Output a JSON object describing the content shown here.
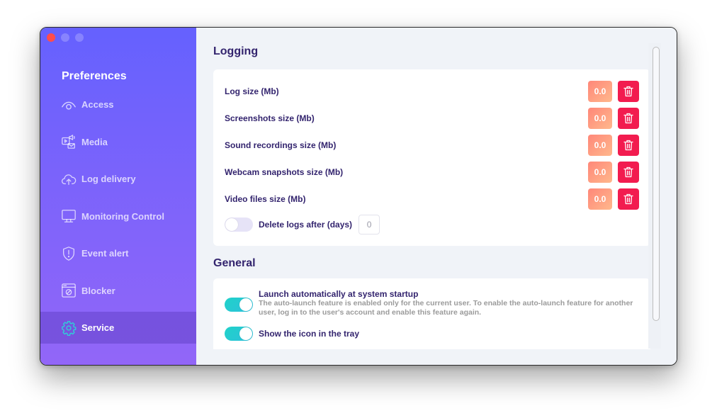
{
  "window": {
    "traffic_lights": [
      "close",
      "minimize",
      "maximize"
    ]
  },
  "sidebar": {
    "title": "Preferences",
    "items": [
      {
        "label": "Access",
        "icon": "eye-icon",
        "active": false
      },
      {
        "label": "Media",
        "icon": "media-icon",
        "active": false
      },
      {
        "label": "Log delivery",
        "icon": "cloud-upload-icon",
        "active": false
      },
      {
        "label": "Monitoring Control",
        "icon": "monitor-icon",
        "active": false
      },
      {
        "label": "Event alert",
        "icon": "shield-alert-icon",
        "active": false
      },
      {
        "label": "Blocker",
        "icon": "blocker-icon",
        "active": false
      },
      {
        "label": "Service",
        "icon": "gear-icon",
        "active": true
      }
    ]
  },
  "logging": {
    "title": "Logging",
    "rows": [
      {
        "label": "Log size (Mb)",
        "value": "0.0"
      },
      {
        "label": "Screenshots size (Mb)",
        "value": "0.0"
      },
      {
        "label": "Sound recordings size (Mb)",
        "value": "0.0"
      },
      {
        "label": "Webcam snapshots size (Mb)",
        "value": "0.0"
      },
      {
        "label": "Video files size (Mb)",
        "value": "0.0"
      }
    ],
    "delete_logs": {
      "label": "Delete logs after (days)",
      "enabled": false,
      "value": "0"
    }
  },
  "general": {
    "title": "General",
    "launch": {
      "title": "Launch automatically at system startup",
      "description": "The auto-launch feature is enabled only for the current user. To enable the auto-launch feature for another user, log in to the user's account and enable this feature again.",
      "enabled": true
    },
    "tray": {
      "title": "Show the icon in the tray",
      "enabled": true
    }
  },
  "colors": {
    "sidebar_top": "#6561fe",
    "sidebar_bottom": "#9266f8",
    "heading": "#33246e",
    "delete_button": "#f21c4f",
    "size_badge": "#ff8779",
    "toggle_on": "#1fd2c9",
    "active_icon": "#2ed1d8"
  }
}
